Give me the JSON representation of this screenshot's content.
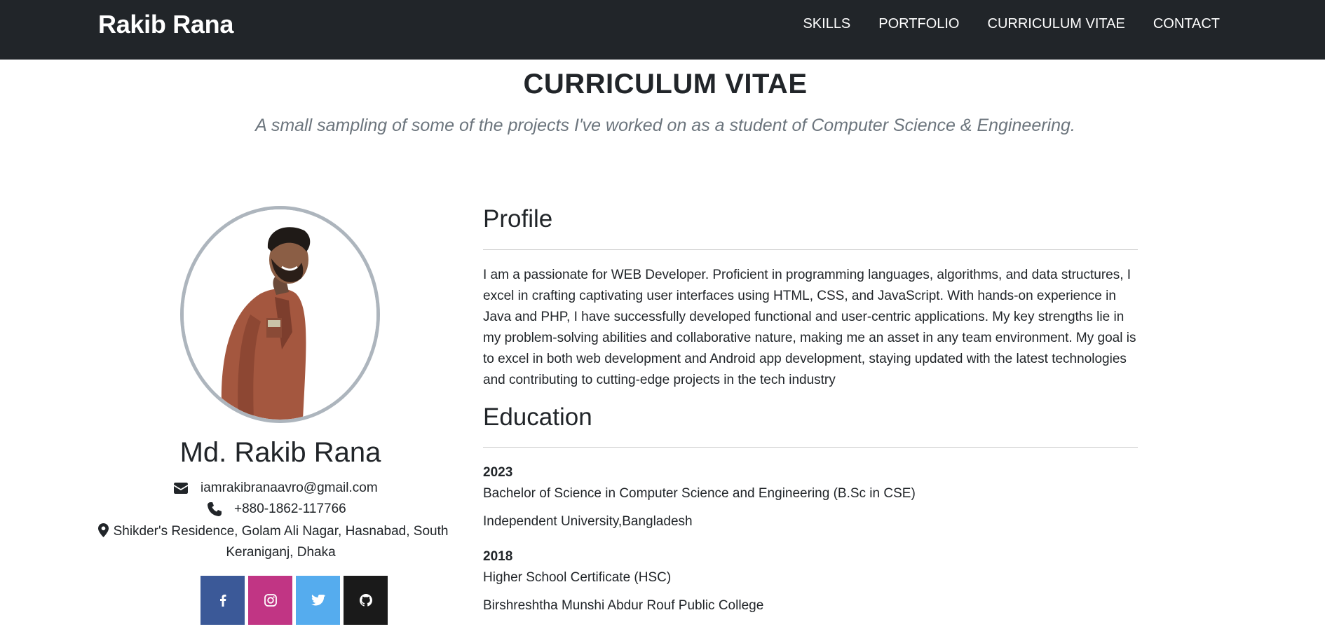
{
  "navbar": {
    "brand": "Rakib Rana",
    "links": [
      "SKILLS",
      "PORTFOLIO",
      "CURRICULUM VITAE",
      "CONTACT"
    ]
  },
  "header": {
    "title": "CURRICULUM VITAE",
    "subtitle": "A small sampling of some of the projects I've worked on as a student of Computer Science & Engineering."
  },
  "sidebar": {
    "name": "Md. Rakib Rana",
    "email": "iamrakibranaavro@gmail.com",
    "phone": "+880-1862-117766",
    "address": "Shikder's Residence, Golam Ali Nagar, Hasnabad, South Keraniganj, Dhaka",
    "social": [
      {
        "name": "facebook-icon",
        "color": "#3b5998"
      },
      {
        "name": "instagram-icon",
        "color": "#c13584"
      },
      {
        "name": "twitter-icon",
        "color": "#55acee"
      },
      {
        "name": "github-icon",
        "color": "#1a1a1a"
      }
    ]
  },
  "profile": {
    "heading": "Profile",
    "text": "I am a passionate for WEB Developer. Proficient in programming languages, algorithms, and data structures, I excel in crafting captivating user interfaces using HTML, CSS, and JavaScript. With hands-on experience in Java and PHP, I have successfully developed functional and user-centric applications. My key strengths lie in my problem-solving abilities and collaborative nature, making me an asset in any team environment. My goal is to excel in both web development and Android app development, staying updated with the latest technologies and contributing to cutting-edge projects in the tech industry"
  },
  "education": {
    "heading": "Education",
    "items": [
      {
        "year": "2023",
        "degree": "Bachelor of Science in Computer Science and Engineering (B.Sc in CSE)",
        "institution": "Independent University,Bangladesh"
      },
      {
        "year": "2018",
        "degree": "Higher School Certificate (HSC)",
        "institution": "Birshreshtha Munshi Abdur Rouf Public College"
      }
    ]
  },
  "colors": {
    "navbar_bg": "#212529",
    "muted_text": "#6c757d",
    "avatar_border": "#adb5bd"
  }
}
